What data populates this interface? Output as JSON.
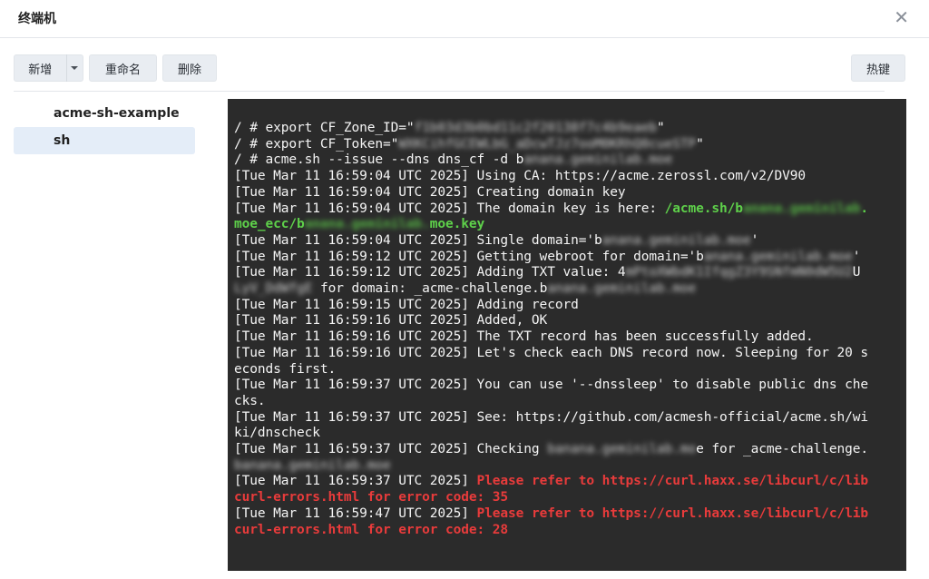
{
  "window": {
    "title": "终端机",
    "close_icon": "close-icon"
  },
  "toolbar": {
    "add_label": "新增",
    "rename_label": "重命名",
    "delete_label": "删除",
    "hotkeys_label": "热键"
  },
  "sessions": [
    {
      "label": "acme-sh-example",
      "selected": false
    },
    {
      "label": "sh",
      "selected": true
    }
  ],
  "colors": {
    "terminal_bg": "#2b2b2b",
    "success_green": "#5ed04a",
    "error_red": "#e83b3b",
    "selected_bg": "#e4edf8"
  },
  "terminal": {
    "lines": [
      [
        {
          "t": "/ # export CF_Zone_ID=\""
        },
        {
          "t": "f1b03d3b0bd11c2f20138f7c4b9eaeb",
          "c": "blur"
        },
        {
          "t": "\""
        }
      ],
      [
        {
          "t": "/ # export CF_Token=\""
        },
        {
          "t": "WXKCihfGCEWLbG_aDcwTJz7ooM0KRhQ0cueSTP",
          "c": "blur"
        },
        {
          "t": "\""
        }
      ],
      [
        {
          "t": "/ # acme.sh --issue --dns dns_cf -d b"
        },
        {
          "t": "anana.geminilab.moe",
          "c": "blur"
        }
      ],
      [
        {
          "t": "[Tue Mar 11 16:59:04 UTC 2025] Using CA: https://acme.zerossl.com/v2/DV90"
        }
      ],
      [
        {
          "t": "[Tue Mar 11 16:59:04 UTC 2025] Creating domain key"
        }
      ],
      [
        {
          "t": "[Tue Mar 11 16:59:04 UTC 2025] The domain key is here: "
        },
        {
          "t": "/acme.sh/b",
          "c": "g"
        },
        {
          "t": "anana.geminilab",
          "c": "g blur"
        },
        {
          "t": ".",
          "c": "g"
        }
      ],
      [
        {
          "t": "moe_ecc/b",
          "c": "g"
        },
        {
          "t": "anana.geminilab.",
          "c": "g blur"
        },
        {
          "t": "moe.key",
          "c": "g"
        }
      ],
      [
        {
          "t": "[Tue Mar 11 16:59:04 UTC 2025] Single domain='b"
        },
        {
          "t": "anana.geminilab.moe",
          "c": "blur"
        },
        {
          "t": "'"
        }
      ],
      [
        {
          "t": "[Tue Mar 11 16:59:12 UTC 2025] Getting webroot for domain='b"
        },
        {
          "t": "anana.geminilab.moe",
          "c": "blur"
        },
        {
          "t": "'"
        }
      ],
      [
        {
          "t": "[Tue Mar 11 16:59:12 UTC 2025] Adding TXT value: 4"
        },
        {
          "t": "mPtoXWbdK1IfqgZ3Y9SNfmN0dW5U2",
          "c": "blur"
        },
        {
          "t": "U"
        }
      ],
      [
        {
          "t": "LyV_DdWfgE",
          "c": "blur"
        },
        {
          "t": " for domain: _acme-challenge.b"
        },
        {
          "t": "anana.geminilab.moe",
          "c": "blur"
        }
      ],
      [
        {
          "t": "[Tue Mar 11 16:59:15 UTC 2025] Adding record"
        }
      ],
      [
        {
          "t": "[Tue Mar 11 16:59:16 UTC 2025] Added, OK"
        }
      ],
      [
        {
          "t": "[Tue Mar 11 16:59:16 UTC 2025] The TXT record has been successfully added."
        }
      ],
      [
        {
          "t": "[Tue Mar 11 16:59:16 UTC 2025] Let's check each DNS record now. Sleeping for 20 s"
        }
      ],
      [
        {
          "t": "econds first."
        }
      ],
      [
        {
          "t": "[Tue Mar 11 16:59:37 UTC 2025] You can use '--dnssleep' to disable public dns che"
        }
      ],
      [
        {
          "t": "cks."
        }
      ],
      [
        {
          "t": "[Tue Mar 11 16:59:37 UTC 2025] See: https://github.com/acmesh-official/acme.sh/wi"
        }
      ],
      [
        {
          "t": "ki/dnscheck"
        }
      ],
      [
        {
          "t": "[Tue Mar 11 16:59:37 UTC 2025] Checking "
        },
        {
          "t": "banana.geminilab.mo",
          "c": "blur"
        },
        {
          "t": "e for _acme-challenge."
        }
      ],
      [
        {
          "t": "banana.geminilab.moe",
          "c": "blur"
        }
      ],
      [
        {
          "t": "[Tue Mar 11 16:59:37 UTC 2025] "
        },
        {
          "t": "Please refer to https://curl.haxx.se/libcurl/c/lib",
          "c": "r"
        }
      ],
      [
        {
          "t": "curl-errors.html for error code: 35",
          "c": "r"
        }
      ],
      [
        {
          "t": "[Tue Mar 11 16:59:47 UTC 2025] "
        },
        {
          "t": "Please refer to https://curl.haxx.se/libcurl/c/lib",
          "c": "r"
        }
      ],
      [
        {
          "t": "curl-errors.html for error code: 28",
          "c": "r"
        }
      ]
    ]
  }
}
